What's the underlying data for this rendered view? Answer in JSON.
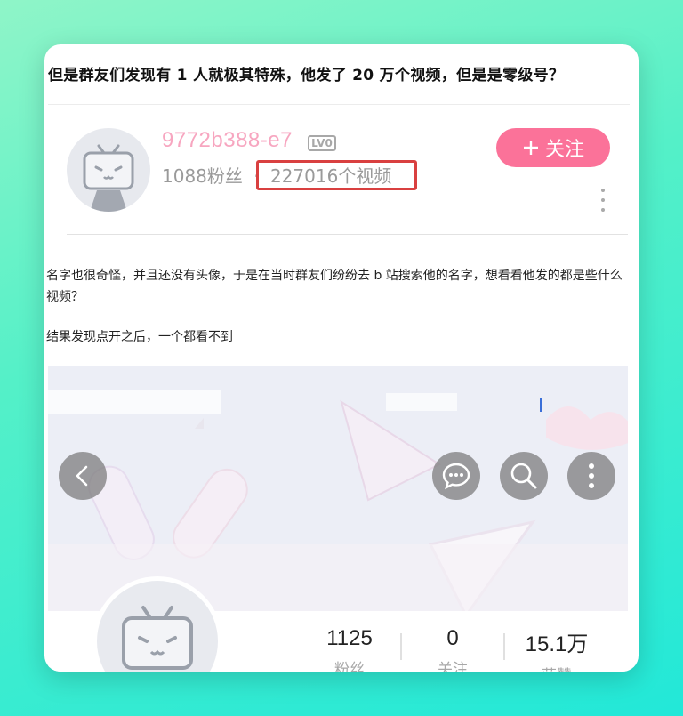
{
  "headline": "但是群友们发现有 1 人就极其特殊，他发了 20 万个视频，但是是零级号？",
  "profile": {
    "username": "9772b388-e7",
    "level": "LV0",
    "fans": "1088粉丝",
    "separator": "·",
    "videos": "227016个视频",
    "follow_label": "关注",
    "follow_icon": "plus-icon",
    "more_icon": "more-vertical-icon"
  },
  "body": {
    "paragraph1": "名字也很奇怪，并且还没有头像，于是在当时群友们纷纷去 b 站搜索他的名字，想看看他发的都是些什么视频？",
    "paragraph2": "结果发现点开之后，一个都看不到"
  },
  "screenshot": {
    "icons": [
      "back-icon",
      "message-icon",
      "search-icon",
      "more-vertical-icon"
    ],
    "stats": [
      {
        "value": "1125",
        "label": "粉丝"
      },
      {
        "value": "0",
        "label": "关注"
      },
      {
        "value": "15.1万",
        "label": "获赞"
      }
    ]
  },
  "colors": {
    "accent_pink": "#fb7299",
    "username_pink": "#f7a6c0",
    "highlight_red": "#d94040"
  }
}
